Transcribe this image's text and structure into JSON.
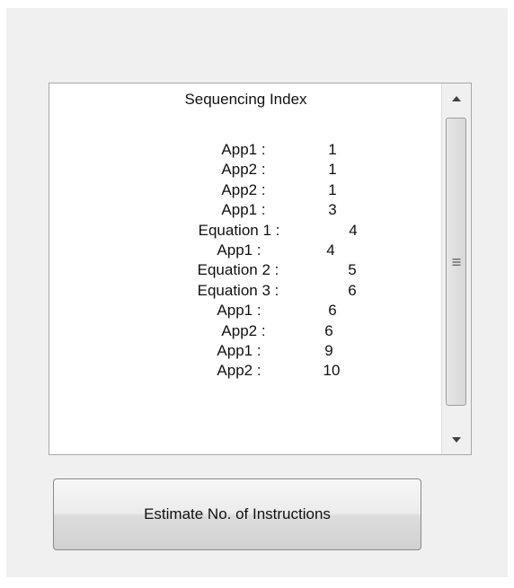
{
  "list": {
    "title": "Sequencing Index",
    "rows": [
      {
        "label": "App1 :",
        "value": "1"
      },
      {
        "label": "App2 :",
        "value": "1"
      },
      {
        "label": "App2 :",
        "value": "1"
      },
      {
        "label": "App1 :",
        "value": "3"
      },
      {
        "label": "Equation 1 :",
        "value": "4"
      },
      {
        "label": "App1 :",
        "value": "4"
      },
      {
        "label": "Equation 2 :",
        "value": "5"
      },
      {
        "label": "Equation 3 :",
        "value": "6"
      },
      {
        "label": "App1 :",
        "value": "6"
      },
      {
        "label": "App2 :",
        "value": "6"
      },
      {
        "label": "App1 :",
        "value": "9"
      },
      {
        "label": "App2 :",
        "value": "10"
      }
    ]
  },
  "scrollbar": {
    "up_icon": "scroll-up-arrow",
    "down_icon": "scroll-down-arrow",
    "grip_icon": "scroll-grip"
  },
  "button": {
    "label": "Estimate No. of Instructions"
  }
}
